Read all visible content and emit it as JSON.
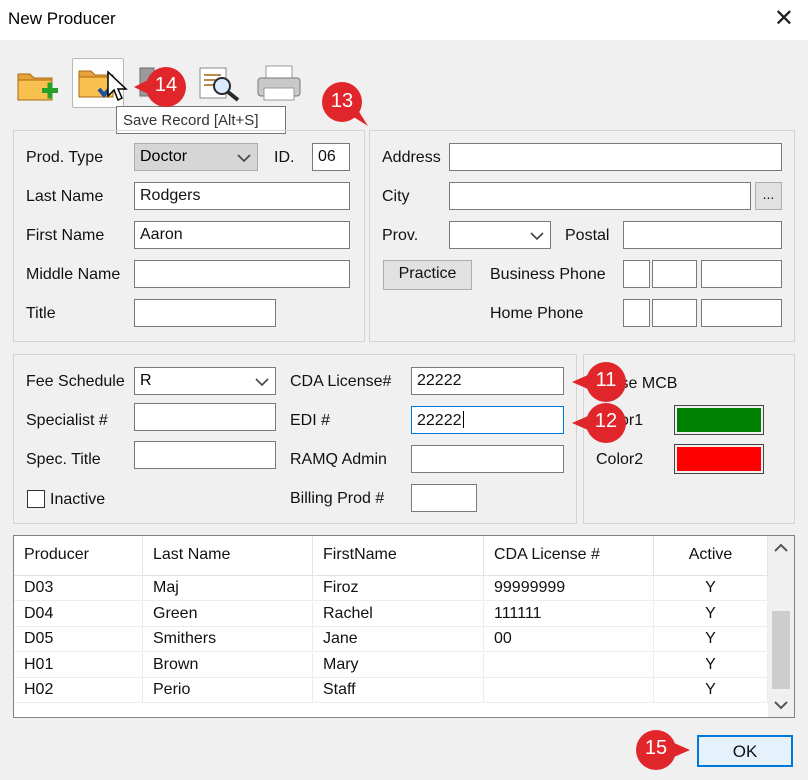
{
  "window": {
    "title": "New Producer",
    "close_glyph": "✕"
  },
  "tooltip": "Save Record [Alt+S]",
  "toolbar": {
    "icons": [
      "new-record-icon",
      "save-record-icon",
      "delete-record-icon",
      "search-icon",
      "print-icon"
    ]
  },
  "producer": {
    "prod_type_label": "Prod. Type",
    "prod_type_value": "Doctor",
    "id_label": "ID.",
    "id_value": "06",
    "last_name_label": "Last Name",
    "last_name_value": "Rodgers",
    "first_name_label": "First Name",
    "first_name_value": "Aaron",
    "middle_name_label": "Middle Name",
    "middle_name_value": "",
    "title_label": "Title",
    "title_value": ""
  },
  "address": {
    "address_label": "Address",
    "address_value": "",
    "city_label": "City",
    "city_value": "",
    "city_browse": "...",
    "prov_label": "Prov.",
    "prov_value": "",
    "postal_label": "Postal",
    "postal_value": "",
    "practice_button": "Practice",
    "business_phone_label": "Business Phone",
    "home_phone_label": "Home Phone"
  },
  "billing": {
    "fee_schedule_label": "Fee Schedule",
    "fee_schedule_value": "R",
    "specialist_label": "Specialist #",
    "specialist_value": "",
    "spec_title_label": "Spec. Title",
    "spec_title_value": "",
    "inactive_label": "Inactive",
    "inactive_checked": false,
    "cda_license_label": "CDA License#",
    "cda_license_value": "22222",
    "edi_label": "EDI #",
    "edi_value": "22222",
    "ramq_admin_label": "RAMQ Admin",
    "ramq_admin_value": "",
    "billing_prod_label": "Billing Prod #",
    "billing_prod_value": ""
  },
  "colors": {
    "use_mcb_label": "Use MCB",
    "color1_label": "Color1",
    "color1": "#008000",
    "color2_label": "Color2",
    "color2": "#ff0000"
  },
  "grid": {
    "columns": [
      "Producer",
      "Last Name",
      "FirstName",
      "CDA License #",
      "Active"
    ],
    "rows": [
      [
        "D03",
        "Maj",
        "Firoz",
        "99999999",
        "Y"
      ],
      [
        "D04",
        "Green",
        "Rachel",
        "111111",
        "Y"
      ],
      [
        "D05",
        "Smithers",
        "Jane",
        "00",
        "Y"
      ],
      [
        "H01",
        "Brown",
        "Mary",
        "",
        "Y"
      ],
      [
        "H02",
        "Perio",
        "Staff",
        "",
        "Y"
      ]
    ]
  },
  "footer": {
    "ok_button": "OK"
  },
  "callouts": {
    "c11": "11",
    "c12": "12",
    "c13": "13",
    "c14": "14",
    "c15": "15",
    "color": "#e0262a"
  }
}
